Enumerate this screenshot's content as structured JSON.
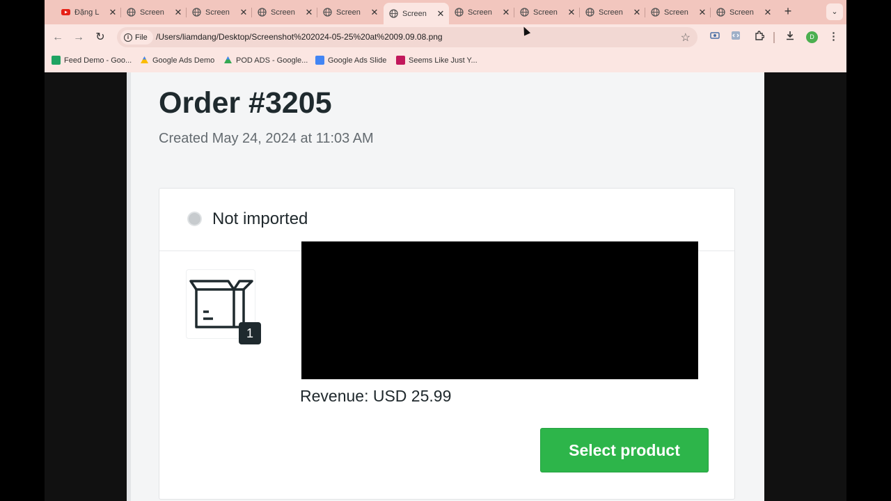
{
  "tabs": [
    {
      "title": "Đặng L",
      "icon": "youtube-icon",
      "active": false
    },
    {
      "title": "Screen",
      "icon": "globe-icon",
      "active": false
    },
    {
      "title": "Screen",
      "icon": "globe-icon",
      "active": false
    },
    {
      "title": "Screen",
      "icon": "globe-icon",
      "active": false
    },
    {
      "title": "Screen",
      "icon": "globe-icon",
      "active": false
    },
    {
      "title": "Screen",
      "icon": "globe-icon",
      "active": true
    },
    {
      "title": "Screen",
      "icon": "globe-icon",
      "active": false
    },
    {
      "title": "Screen",
      "icon": "globe-icon",
      "active": false
    },
    {
      "title": "Screen",
      "icon": "globe-icon",
      "active": false
    },
    {
      "title": "Screen",
      "icon": "globe-icon",
      "active": false
    },
    {
      "title": "Screen",
      "icon": "globe-icon",
      "active": false
    }
  ],
  "toolbar": {
    "chip_label": "File",
    "url": "/Users/liamdang/Desktop/Screenshot%202024-05-25%20at%2009.09.08.png",
    "avatar_letter": "D"
  },
  "bookmarks": [
    {
      "label": "Feed Demo - Goo...",
      "icon": "sheets-icon",
      "color": "#1ea362"
    },
    {
      "label": "Google Ads Demo",
      "icon": "google-ads-icon",
      "color": "#fbbc04"
    },
    {
      "label": "POD ADS - Google...",
      "icon": "drive-icon",
      "color": "#34a853"
    },
    {
      "label": "Google Ads Slide",
      "icon": "forms-icon",
      "color": "#4285f4"
    },
    {
      "label": "Seems Like Just Y...",
      "icon": "bookmark-site-icon",
      "color": "#c2185b"
    }
  ],
  "order": {
    "title": "Order #3205",
    "created": "Created May 24, 2024 at 11:03 AM",
    "status": "Not imported",
    "quantity": "1",
    "revenue": "Revenue: USD 25.99",
    "select_button": "Select product"
  },
  "colors": {
    "tab_strip": "#f2c6be",
    "toolbar": "#fbe6e2",
    "primary_button": "#2db54a",
    "status_dot": "#c7cbce"
  }
}
